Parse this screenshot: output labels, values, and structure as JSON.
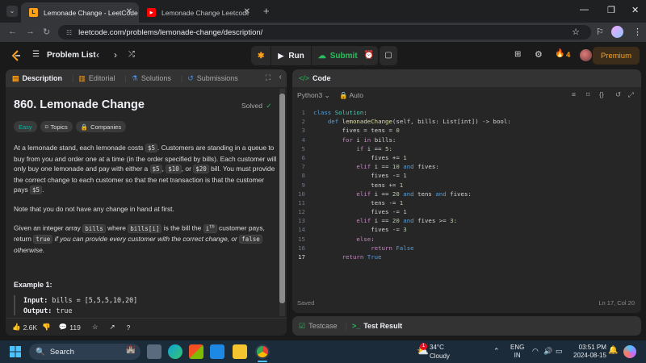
{
  "browser": {
    "tabs": [
      {
        "title": "Lemonade Change - LeetCode",
        "active": true
      },
      {
        "title": "Lemonade Change Leetcode Py",
        "active": false
      }
    ],
    "url": "leetcode.com/problems/lemonade-change/description/"
  },
  "header": {
    "problem_list": "Problem List",
    "run": "Run",
    "submit": "Submit",
    "streak": "4",
    "premium": "Premium"
  },
  "left_panel": {
    "tabs": [
      "Description",
      "Editorial",
      "Solutions",
      "Submissions"
    ],
    "title": "860. Lemonade Change",
    "status": "Solved",
    "chips": [
      "Easy",
      "Topics",
      "Companies"
    ],
    "p1": [
      "At a lemonade stand, each lemonade costs ",
      "$5",
      ". Customers are standing in a queue to buy from you and order one at a time (in the order specified by bills). Each customer will only buy one lemonade and pay with either a ",
      "$5",
      ", ",
      "$10",
      ", or ",
      "$20",
      " bill. You must provide the correct change to each customer so that the net transaction is that the customer pays ",
      "$5",
      "."
    ],
    "p2": "Note that you do not have any change in hand at first.",
    "p3": {
      "a": "Given an integer array ",
      "code1": "bills",
      "b": " where ",
      "code2": "bills[i]",
      "c": " is the bill the ",
      "d": "i",
      "sup": "th",
      "e": " customer pays, return ",
      "code3": "true",
      "f": " if you can provide every customer with the correct change, or ",
      "code4": "false",
      "g": " otherwise."
    },
    "example_title": "Example 1:",
    "example_input_label": "Input:",
    "example_input": "bills = [5,5,5,10,20]",
    "example_output_label": "Output:",
    "example_output": "true",
    "likes": "2.6K",
    "comments": "119"
  },
  "right_panel": {
    "title": "Code",
    "language": "Python3",
    "mode": "Auto",
    "status_left": "Saved",
    "status_right": "Ln 17, Col 20",
    "bottom_tabs": [
      "Testcase",
      "Test Result"
    ],
    "current_line": 17
  },
  "code_lines": [
    [
      [
        "kw2",
        "class "
      ],
      [
        "bi",
        "Solution"
      ],
      [
        "ct",
        ":"
      ]
    ],
    [
      [
        "ct",
        "    "
      ],
      [
        "kw2",
        "def "
      ],
      [
        "fn",
        "lemonadeChange"
      ],
      [
        "ct",
        "(self, bills: List[int]) -> bool:"
      ]
    ],
    [
      [
        "ct",
        "        fives = tens = "
      ],
      [
        "nm",
        "0"
      ]
    ],
    [
      [
        "ct",
        "        "
      ],
      [
        "kw",
        "for "
      ],
      [
        "ct",
        "i "
      ],
      [
        "kw",
        "in "
      ],
      [
        "ct",
        "bills:"
      ]
    ],
    [
      [
        "ct",
        "            "
      ],
      [
        "kw",
        "if "
      ],
      [
        "ct",
        "i == "
      ],
      [
        "nm",
        "5"
      ],
      [
        "ct",
        ":"
      ]
    ],
    [
      [
        "ct",
        "                fives += "
      ],
      [
        "nm",
        "1"
      ]
    ],
    [
      [
        "ct",
        "            "
      ],
      [
        "kw",
        "elif "
      ],
      [
        "ct",
        "i == "
      ],
      [
        "nm",
        "10 "
      ],
      [
        "kw2",
        "and "
      ],
      [
        "ct",
        "fives:"
      ]
    ],
    [
      [
        "ct",
        "                fives -= "
      ],
      [
        "nm",
        "1"
      ]
    ],
    [
      [
        "ct",
        "                tens += "
      ],
      [
        "nm",
        "1"
      ]
    ],
    [
      [
        "ct",
        "            "
      ],
      [
        "kw",
        "elif "
      ],
      [
        "ct",
        "i == "
      ],
      [
        "nm",
        "20 "
      ],
      [
        "kw2",
        "and "
      ],
      [
        "ct",
        "tens "
      ],
      [
        "kw2",
        "and "
      ],
      [
        "ct",
        "fives:"
      ]
    ],
    [
      [
        "ct",
        "                tens -= "
      ],
      [
        "nm",
        "1"
      ]
    ],
    [
      [
        "ct",
        "                fives -= "
      ],
      [
        "nm",
        "1"
      ]
    ],
    [
      [
        "ct",
        "            "
      ],
      [
        "kw",
        "elif "
      ],
      [
        "ct",
        "i == "
      ],
      [
        "nm",
        "20 "
      ],
      [
        "kw2",
        "and "
      ],
      [
        "ct",
        "fives >= "
      ],
      [
        "nm",
        "3"
      ],
      [
        "ct",
        ":"
      ]
    ],
    [
      [
        "ct",
        "                fives -= "
      ],
      [
        "nm",
        "3"
      ]
    ],
    [
      [
        "ct",
        "            "
      ],
      [
        "kw",
        "else"
      ],
      [
        "ct",
        ":"
      ]
    ],
    [
      [
        "ct",
        "                "
      ],
      [
        "kw",
        "return "
      ],
      [
        "kw2",
        "False"
      ]
    ],
    [
      [
        "ct",
        "        "
      ],
      [
        "kw",
        "return "
      ],
      [
        "kw2",
        "True"
      ]
    ]
  ],
  "taskbar": {
    "search": "Search",
    "weather_temp": "34°C",
    "weather_desc": "Cloudy",
    "weather_badge": "1",
    "lang_top": "ENG",
    "lang_bottom": "IN",
    "time": "03:51 PM",
    "date": "2024-08-15"
  },
  "colors": {
    "accent_orange": "#ffa116",
    "easy_teal": "#00b8a3",
    "submit_green": "#2cbb5d",
    "solved_green": "#2cbb5d"
  }
}
